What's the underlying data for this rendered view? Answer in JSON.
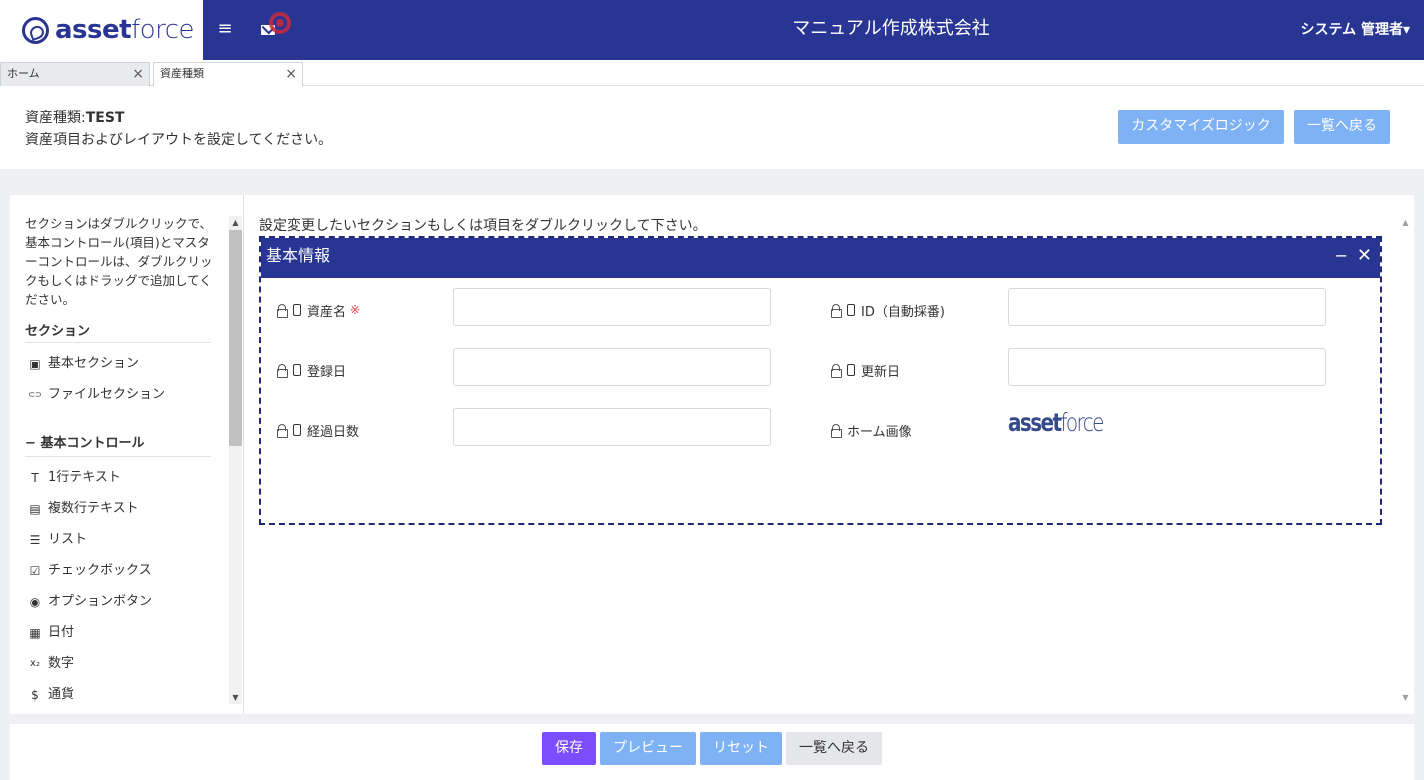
{
  "header": {
    "logo_bold": "asset",
    "logo_light": "force",
    "company": "マニュアル作成株式会社",
    "user": "システム 管理者",
    "user_caret": "▾",
    "menu_icon": "≡"
  },
  "tabs": [
    {
      "label": "ホーム",
      "close": "×"
    },
    {
      "label": "資産種類",
      "close": "×"
    }
  ],
  "title": {
    "prefix": "資産種類:",
    "name": "TEST",
    "description": "資産項目およびレイアウトを設定してください。",
    "customize_button": "カスタマイズロジック",
    "back_button": "一覧へ戻る"
  },
  "sidebar": {
    "help": "セクションはダブルクリックで、基本コントロール(項目)とマスターコントロールは、ダブルクリックもしくはドラッグで追加してください。",
    "section_header": "セクション",
    "sections": [
      {
        "icon": "id-card-icon",
        "glyph": "▣",
        "label": "基本セクション"
      },
      {
        "icon": "link-icon",
        "glyph": "⊂⊃",
        "label": "ファイルセクション"
      }
    ],
    "controls_header": "基本コントロール",
    "controls_collapse": "−",
    "controls": [
      {
        "icon": "text-icon",
        "glyph": "T",
        "label": "1行テキスト"
      },
      {
        "icon": "note-icon",
        "glyph": "▤",
        "label": "複数行テキスト"
      },
      {
        "icon": "list-icon",
        "glyph": "☰",
        "label": "リスト"
      },
      {
        "icon": "checkbox-icon",
        "glyph": "☑",
        "label": "チェックボックス"
      },
      {
        "icon": "radio-icon",
        "glyph": "◉",
        "label": "オプションボタン"
      },
      {
        "icon": "calendar-icon",
        "glyph": "▦",
        "label": "日付"
      },
      {
        "icon": "subscript-icon",
        "glyph": "x₂",
        "label": "数字"
      },
      {
        "icon": "dollar-icon",
        "glyph": "$",
        "label": "通貨"
      }
    ]
  },
  "canvas": {
    "help": "設定変更したいセクションもしくは項目をダブルクリックして下さい。",
    "section": {
      "title": "基本情報",
      "minimize": "−",
      "close": "✕",
      "fields": [
        {
          "label": "資産名",
          "required": "※",
          "value": ""
        },
        {
          "label": "ID（自動採番)",
          "value": ""
        },
        {
          "label": "登録日",
          "value": ""
        },
        {
          "label": "更新日",
          "value": ""
        },
        {
          "label": "経過日数",
          "value": ""
        },
        {
          "label": "ホーム画像"
        }
      ],
      "home_image_bold": "asset",
      "home_image_light": "force"
    }
  },
  "footer": {
    "save": "保存",
    "preview": "プレビュー",
    "reset": "リセット",
    "back": "一覧へ戻る"
  },
  "colors": {
    "brand": "#283593",
    "save": "#7c4dff",
    "light_button": "#7fb2f5",
    "required": "#e04444"
  }
}
